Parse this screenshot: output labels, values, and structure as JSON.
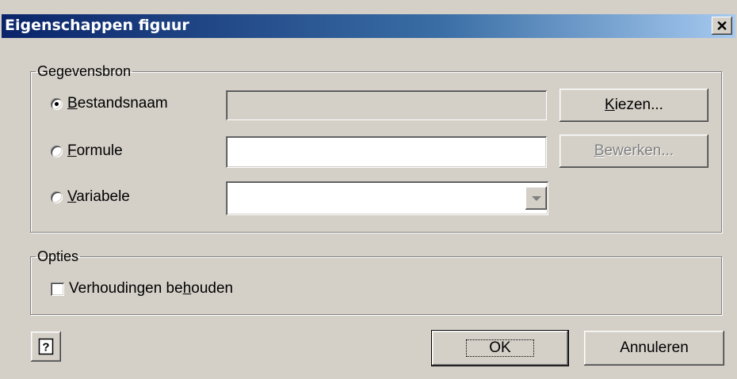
{
  "window": {
    "title": "Eigenschappen figuur",
    "close_glyph": "✕"
  },
  "datasource": {
    "legend": "Gegevensbron",
    "options": [
      {
        "mnemonic": "B",
        "rest": "estandsnaam",
        "selected": true
      },
      {
        "mnemonic": "F",
        "rest": "ormule",
        "selected": false
      },
      {
        "mnemonic": "V",
        "rest": "ariabele",
        "selected": false
      }
    ],
    "filename_value": "",
    "formula_value": "",
    "variable_value": ""
  },
  "buttons": {
    "choose": {
      "mnemonic": "K",
      "rest": "iezen..."
    },
    "edit": {
      "mnemonic": "B",
      "rest": "ewerken...",
      "enabled": false
    },
    "ok": "OK",
    "cancel": "Annuleren"
  },
  "options": {
    "legend": "Opties",
    "keep_ratio": {
      "pre": "Verhoudingen be",
      "mnemonic": "h",
      "post": "ouden",
      "checked": false
    }
  },
  "help": {
    "icon": "help-icon"
  }
}
